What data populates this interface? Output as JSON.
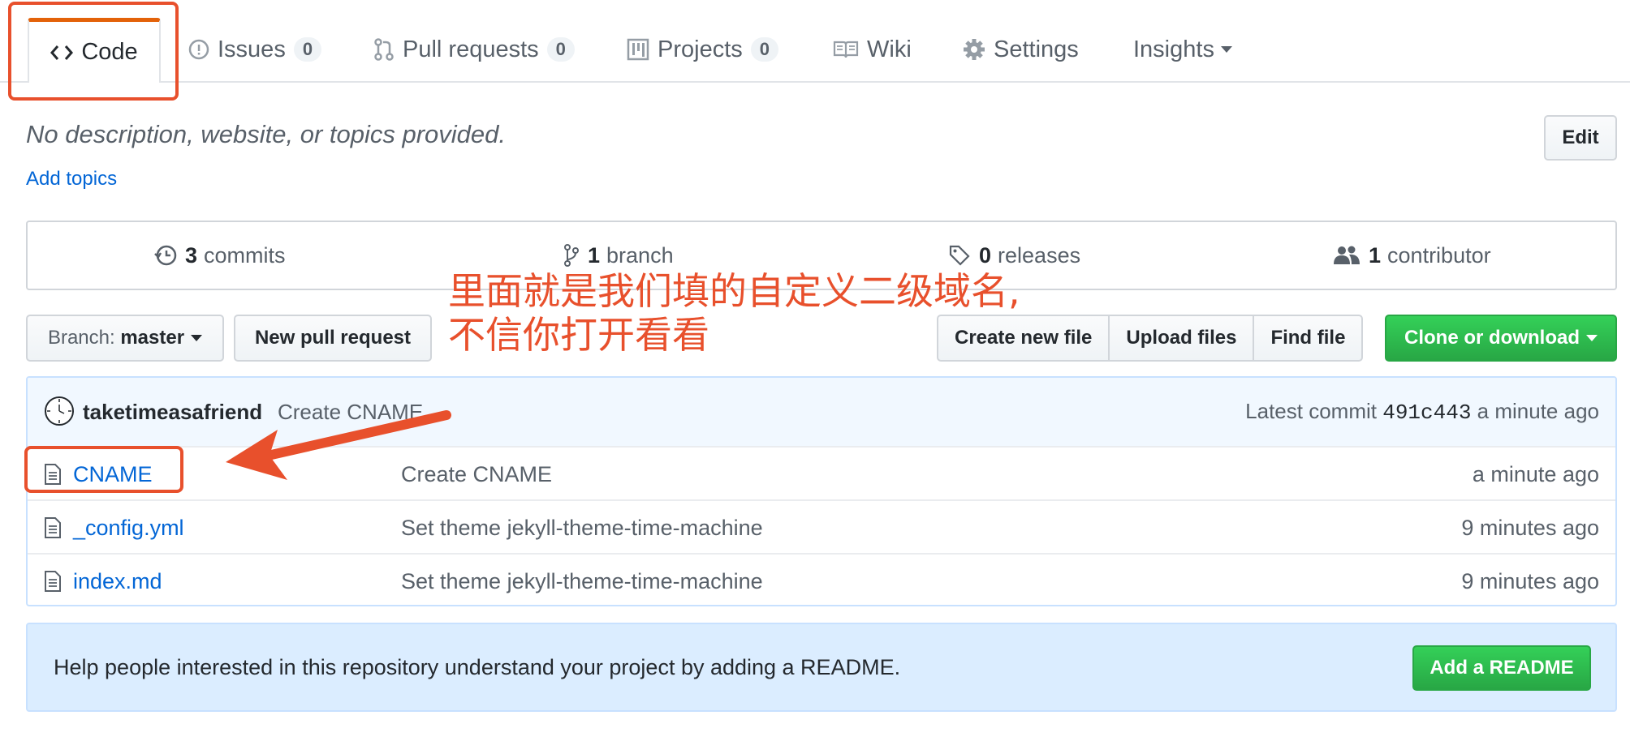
{
  "tabs": {
    "code": "Code",
    "issues": {
      "label": "Issues",
      "count": "0"
    },
    "pulls": {
      "label": "Pull requests",
      "count": "0"
    },
    "projects": {
      "label": "Projects",
      "count": "0"
    },
    "wiki": "Wiki",
    "settings": "Settings",
    "insights": "Insights"
  },
  "repo": {
    "description": "No description, website, or topics provided.",
    "add_topics": "Add topics",
    "edit_label": "Edit"
  },
  "summary": {
    "commits": {
      "count": "3",
      "label": "commits"
    },
    "branches": {
      "count": "1",
      "label": "branch"
    },
    "releases": {
      "count": "0",
      "label": "releases"
    },
    "contributors": {
      "count": "1",
      "label": "contributor"
    }
  },
  "toolbar": {
    "branch_prefix": "Branch:",
    "branch_name": "master",
    "new_pr": "New pull request",
    "create_file": "Create new file",
    "upload_files": "Upload files",
    "find_file": "Find file",
    "clone": "Clone or download"
  },
  "latest_commit": {
    "author": "taketimeasafriend",
    "message": "Create CNAME",
    "prefix": "Latest commit",
    "sha": "491c443",
    "age": "a minute ago"
  },
  "files": [
    {
      "name": "CNAME",
      "message": "Create CNAME",
      "age": "a minute ago"
    },
    {
      "name": "_config.yml",
      "message": "Set theme jekyll-theme-time-machine",
      "age": "9 minutes ago"
    },
    {
      "name": "index.md",
      "message": "Set theme jekyll-theme-time-machine",
      "age": "9 minutes ago"
    }
  ],
  "readme": {
    "prompt": "Help people interested in this repository understand your project by adding a README.",
    "button": "Add a README"
  },
  "annotation": {
    "line1": "里面就是我们填的自定义二级域名,",
    "line2": "不信你打开看看",
    "color": "#e8502c"
  },
  "colors": {
    "link": "#0366d6",
    "accent_tab": "#e36209",
    "green": "#28a745",
    "muted": "#586069"
  }
}
